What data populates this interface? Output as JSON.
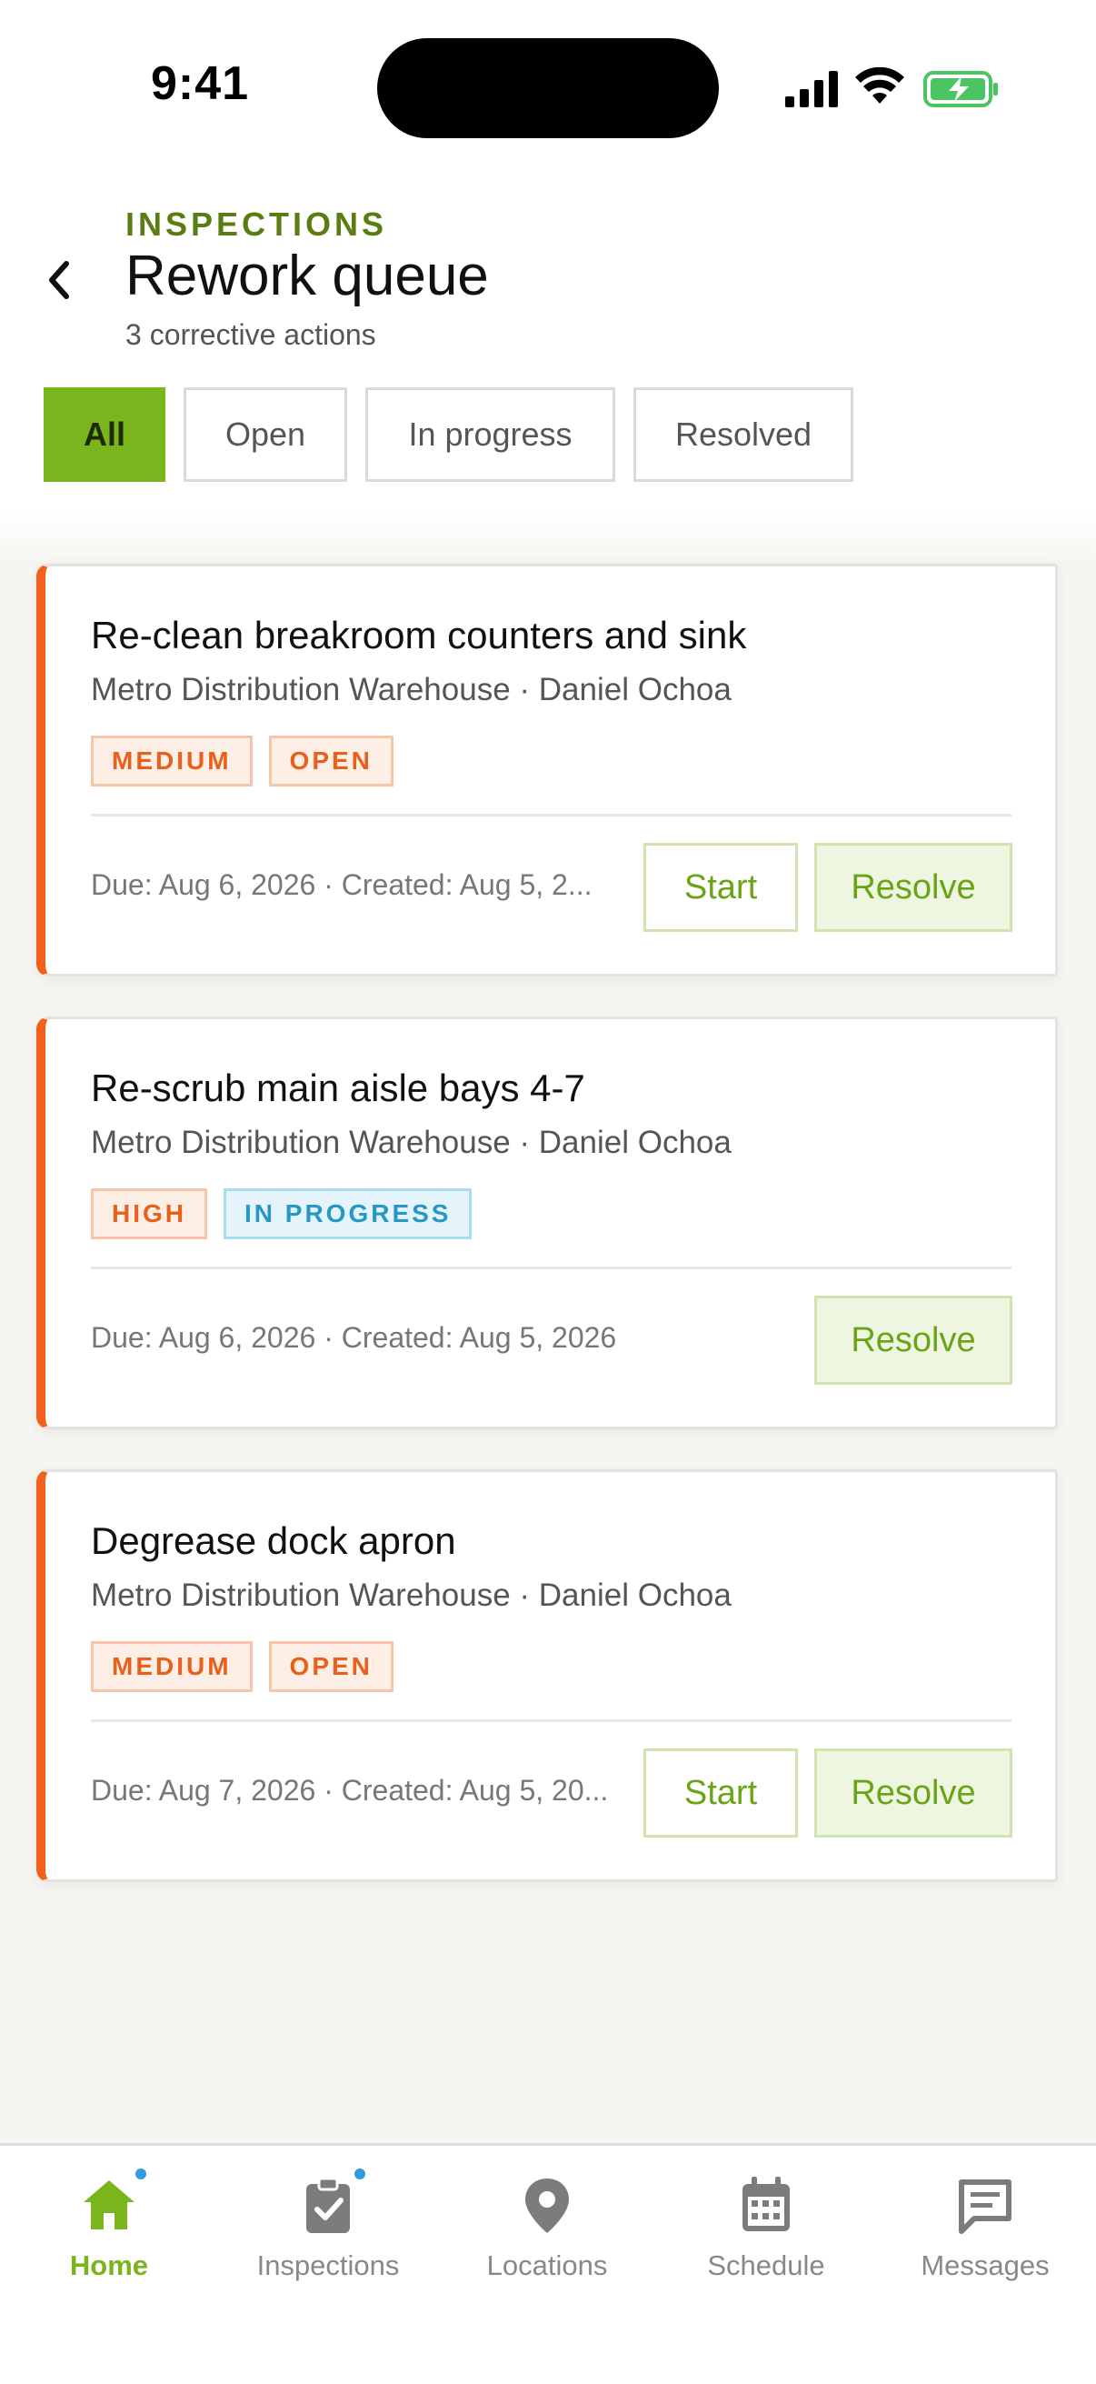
{
  "status_bar": {
    "time": "9:41"
  },
  "header": {
    "eyebrow": "INSPECTIONS",
    "title": "Rework queue",
    "subtitle": "3 corrective actions"
  },
  "filters": [
    {
      "label": "All",
      "active": true
    },
    {
      "label": "Open",
      "active": false
    },
    {
      "label": "In progress",
      "active": false
    },
    {
      "label": "Resolved",
      "active": false
    }
  ],
  "cards": [
    {
      "title": "Re-clean breakroom counters and sink",
      "subtitle": "Metro Distribution Warehouse · Daniel Ochoa",
      "priority": "MEDIUM",
      "status": "OPEN",
      "meta": "Due: Aug 6, 2026 · Created: Aug 5, 2...",
      "start_label": "Start",
      "resolve_label": "Resolve"
    },
    {
      "title": "Re-scrub main aisle bays 4-7",
      "subtitle": "Metro Distribution Warehouse · Daniel Ochoa",
      "priority": "HIGH",
      "status": "IN PROGRESS",
      "meta": "Due: Aug 6, 2026 · Created: Aug 5, 2026",
      "resolve_label": "Resolve"
    },
    {
      "title": "Degrease dock apron",
      "subtitle": "Metro Distribution Warehouse · Daniel Ochoa",
      "priority": "MEDIUM",
      "status": "OPEN",
      "meta": "Due: Aug 7, 2026 · Created: Aug 5, 20...",
      "start_label": "Start",
      "resolve_label": "Resolve"
    }
  ],
  "nav": [
    {
      "label": "Home",
      "icon": "home-icon",
      "active": true,
      "badge": true
    },
    {
      "label": "Inspections",
      "icon": "clipboard-check-icon",
      "active": false,
      "badge": true
    },
    {
      "label": "Locations",
      "icon": "map-pin-icon",
      "active": false,
      "badge": false
    },
    {
      "label": "Schedule",
      "icon": "calendar-icon",
      "active": false,
      "badge": false
    },
    {
      "label": "Messages",
      "icon": "message-icon",
      "active": false,
      "badge": false
    }
  ],
  "colors": {
    "accent": "#7ab51d",
    "priority_orange": "#f0621b",
    "in_progress_blue": "#2798c4",
    "eyebrow_green": "#5a7d12"
  }
}
